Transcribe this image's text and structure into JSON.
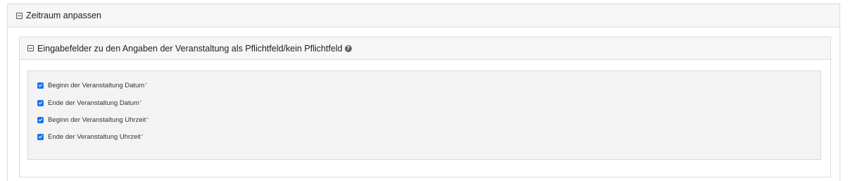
{
  "outer_section": {
    "title": "Zeitraum anpassen"
  },
  "inner_section": {
    "title": "Eingabefelder zu den Angaben der Veranstaltung als Pflichtfeld/kein Pflichtfeld",
    "help_glyph": "?"
  },
  "fields": [
    {
      "label": "Beginn der Veranstaltung Datum",
      "marker": "*",
      "checked": true
    },
    {
      "label": "Ende der Veranstaltung Datum",
      "marker": "*",
      "checked": true
    },
    {
      "label": "Beginn der Veranstaltung Uhrzeit",
      "marker": "*",
      "checked": true
    },
    {
      "label": "Ende der Veranstaltung Uhrzeit",
      "marker": "*",
      "checked": true
    }
  ],
  "colors": {
    "checkbox": "#1a73e8",
    "header_bg": "#f6f6f6",
    "fields_bg": "#f3f3f3"
  }
}
